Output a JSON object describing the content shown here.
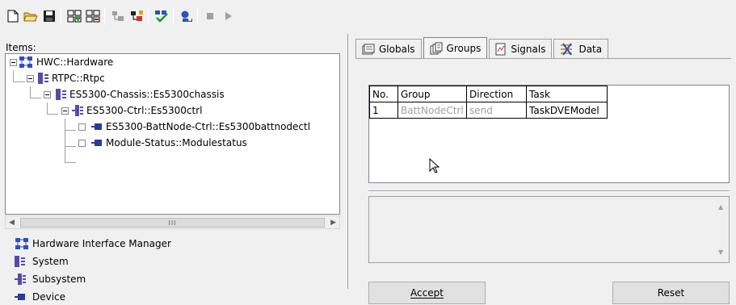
{
  "toolbar": {
    "buttons": [
      "new-icon",
      "open-icon",
      "save-icon",
      "add-group-icon",
      "remove-group-icon",
      "import-icon",
      "export-icon",
      "check-icon",
      "settings-icon",
      "stop-icon",
      "play-icon"
    ]
  },
  "left": {
    "items_label": "Items:",
    "tree": [
      {
        "label": "HWC::Hardware",
        "icon": "hardware-icon"
      },
      {
        "label": "RTPC::Rtpc",
        "icon": "system-icon"
      },
      {
        "label": "ES5300-Chassis::Es5300chassis",
        "icon": "system-icon"
      },
      {
        "label": "ES5300-Ctrl::Es5300ctrl",
        "icon": "subsystem-icon"
      },
      {
        "label": "ES5300-BattNode-Ctrl::Es5300battnodectl",
        "icon": "device-icon"
      },
      {
        "label": "Module-Status::Modulestatus",
        "icon": "device-icon"
      }
    ],
    "scroll_thumb": "III",
    "legend": [
      {
        "label": "Hardware Interface Manager",
        "icon": "hardware-icon"
      },
      {
        "label": "System",
        "icon": "system-icon"
      },
      {
        "label": "Subsystem",
        "icon": "subsystem-icon"
      },
      {
        "label": "Device",
        "icon": "device-icon"
      }
    ]
  },
  "right": {
    "tabs": [
      {
        "label": "Globals",
        "icon": "globals-icon"
      },
      {
        "label": "Groups",
        "icon": "groups-icon",
        "active": true
      },
      {
        "label": "Signals",
        "icon": "signals-icon"
      },
      {
        "label": "Data",
        "icon": "data-icon"
      }
    ],
    "grid": {
      "headers": [
        "No.",
        "Group",
        "Direction",
        "Task"
      ],
      "rows": [
        [
          "1",
          "BattNodeCtrl",
          "send",
          "TaskDVEModel"
        ]
      ]
    },
    "accept_label": "Accept",
    "reset_label": "Reset"
  }
}
